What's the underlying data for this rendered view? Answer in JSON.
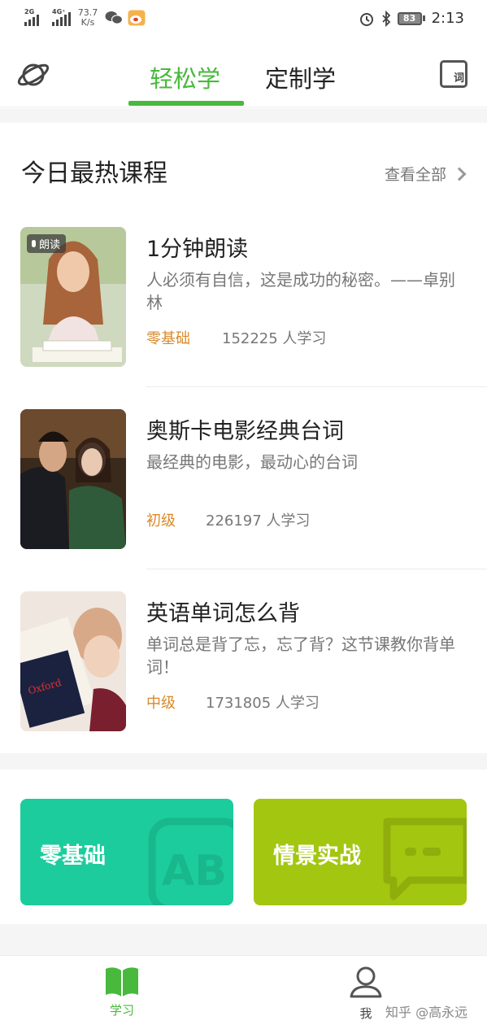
{
  "status_bar": {
    "signal1_label": "2G",
    "signal2_label": "4G⁺",
    "net_speed": "73.7",
    "net_speed_unit": "K/s",
    "battery": "83",
    "time": "2:13"
  },
  "top_nav": {
    "tabs": [
      {
        "label": "轻松学",
        "active": true
      },
      {
        "label": "定制学",
        "active": false
      }
    ],
    "word_button_label": "词"
  },
  "section": {
    "title": "今日最热课程",
    "view_all": "查看全部"
  },
  "courses": [
    {
      "title": "1分钟朗读",
      "description": "人必须有自信，这是成功的秘密。——卓别林",
      "level": "零基础",
      "learners": "152225 人学习",
      "badge": "朗读"
    },
    {
      "title": "奥斯卡电影经典台词",
      "description": "最经典的电影，最动心的台词",
      "level": "初级",
      "learners": "226197 人学习"
    },
    {
      "title": "英语单词怎么背",
      "description": "单词总是背了忘，忘了背？这节课教你背单词！",
      "level": "中级",
      "learners": "1731805 人学习"
    }
  ],
  "categories": [
    {
      "label": "零基础",
      "color": "#1ccc9d"
    },
    {
      "label": "情景实战",
      "color": "#a3c611"
    }
  ],
  "bottom_nav": {
    "study_label": "学习",
    "me_label": "我",
    "watermark": "知乎 @高永远"
  },
  "colors": {
    "accent_green": "#48b93c",
    "level_orange": "#d98a2b"
  }
}
